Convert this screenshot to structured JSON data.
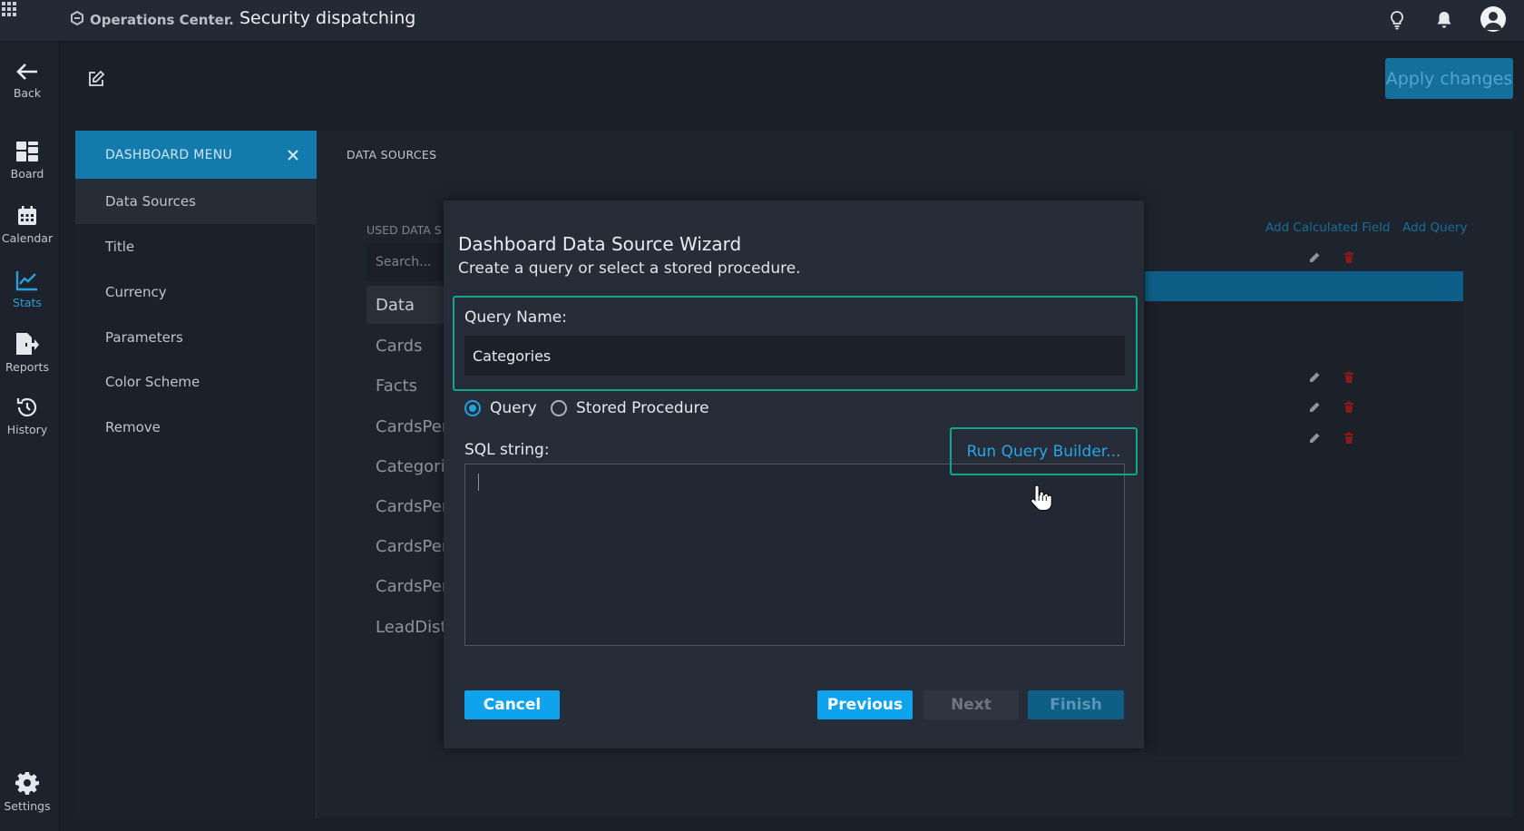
{
  "topbar": {
    "brand": "Operations Center.",
    "title": "Security dispatching",
    "icons": [
      "apps-grid-icon",
      "lightbulb-icon",
      "bell-icon",
      "user-avatar"
    ]
  },
  "rail": {
    "back": "Back",
    "board": "Board",
    "calendar": "Calendar",
    "stats": "Stats",
    "reports": "Reports",
    "history": "History",
    "settings": "Settings"
  },
  "toolbar": {
    "apply_label": "Apply changes"
  },
  "menu": {
    "header": "DASHBOARD MENU",
    "items": [
      "Data Sources",
      "Title",
      "Currency",
      "Parameters",
      "Color Scheme",
      "Remove"
    ]
  },
  "panel": {
    "title": "DATA SOURCES",
    "used_label": "USED DATA S",
    "search_placeholder": "Search...",
    "sources": [
      "Data",
      "Cards",
      "Facts",
      "CardsPer",
      "Categorie",
      "CardsPer",
      "CardsPer",
      "CardsPer",
      "LeadDistr"
    ],
    "add_calculated_field": "Add Calculated Field",
    "add_query": "Add Query"
  },
  "dialog": {
    "title": "Dashboard Data Source Wizard",
    "subtitle": "Create a query or select a stored procedure.",
    "query_name_label": "Query Name:",
    "query_name_value": "Categories",
    "radio_query": "Query",
    "radio_stored": "Stored Procedure",
    "selected_radio": "Query",
    "sql_label": "SQL string:",
    "run_query_builder": "Run Query Builder...",
    "sql_value": "",
    "buttons": {
      "cancel": "Cancel",
      "previous": "Previous",
      "next": "Next",
      "finish": "Finish"
    }
  },
  "colors": {
    "accent": "#0ea3ec",
    "focus_border": "#14a58b",
    "menu_header": "#137bab",
    "delete_icon": "#8a1a1a"
  }
}
